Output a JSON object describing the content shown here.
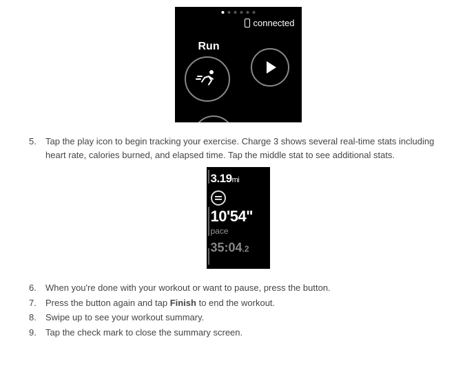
{
  "screenshot1": {
    "connected_label": "connected",
    "mode_label": "Run"
  },
  "screenshot2": {
    "distance_value": "3.19",
    "distance_unit": "mi",
    "pace_value": "10'54\"",
    "pace_label": "pace",
    "time_main": "35:04",
    "time_dec": ".2"
  },
  "steps": {
    "s5": "Tap the play icon to begin tracking your exercise. Charge 3 shows several real-time stats including heart rate, calories burned, and elapsed time. Tap the middle stat to see additional stats.",
    "s6": "When you're done with your workout or want to pause, press the button.",
    "s7_a": "Press the button again and tap ",
    "s7_b": "Finish",
    "s7_c": " to end the workout.",
    "s8": "Swipe up to see your workout summary.",
    "s9": "Tap the check mark to close the summary screen."
  }
}
